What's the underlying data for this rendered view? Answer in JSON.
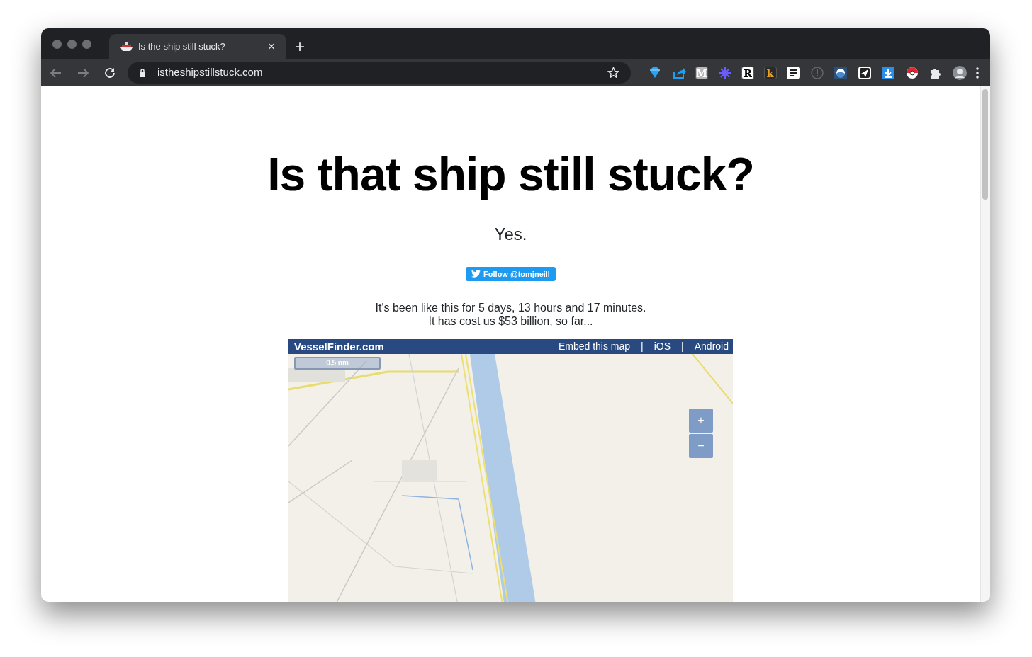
{
  "browser": {
    "tab": {
      "title": "Is the ship still stuck?",
      "selected": true
    },
    "new_tab": "+",
    "close": "×",
    "url": "istheshipstillstuck.com",
    "extensions": [
      {
        "kind": "gem"
      },
      {
        "kind": "share"
      },
      {
        "kind": "tile",
        "label": "M",
        "color": "#b8b8b8"
      },
      {
        "kind": "sparkle"
      },
      {
        "kind": "tile",
        "label": "R",
        "color": "#ffffff"
      },
      {
        "kind": "tile",
        "label": "k",
        "color": "#2a2a2a"
      },
      {
        "kind": "lines"
      },
      {
        "kind": "alert"
      },
      {
        "kind": "disc"
      },
      {
        "kind": "send"
      },
      {
        "kind": "download"
      },
      {
        "kind": "ball"
      },
      {
        "kind": "puzzle"
      },
      {
        "kind": "avatar"
      }
    ]
  },
  "page": {
    "heading": "Is that ship still stuck?",
    "answer": "Yes.",
    "follow_button": "Follow @tomjneill",
    "status_lines": [
      "It's been like this for 5 days, 13 hours and 17 minutes.",
      "It has cost us $53 billion, so far..."
    ],
    "map": {
      "brand": "VesselFinder.com",
      "links": [
        "Embed this map",
        "iOS",
        "Android"
      ],
      "separator": "|",
      "scale": "0.5 nm",
      "zoom_in": "+",
      "zoom_out": "−"
    }
  }
}
